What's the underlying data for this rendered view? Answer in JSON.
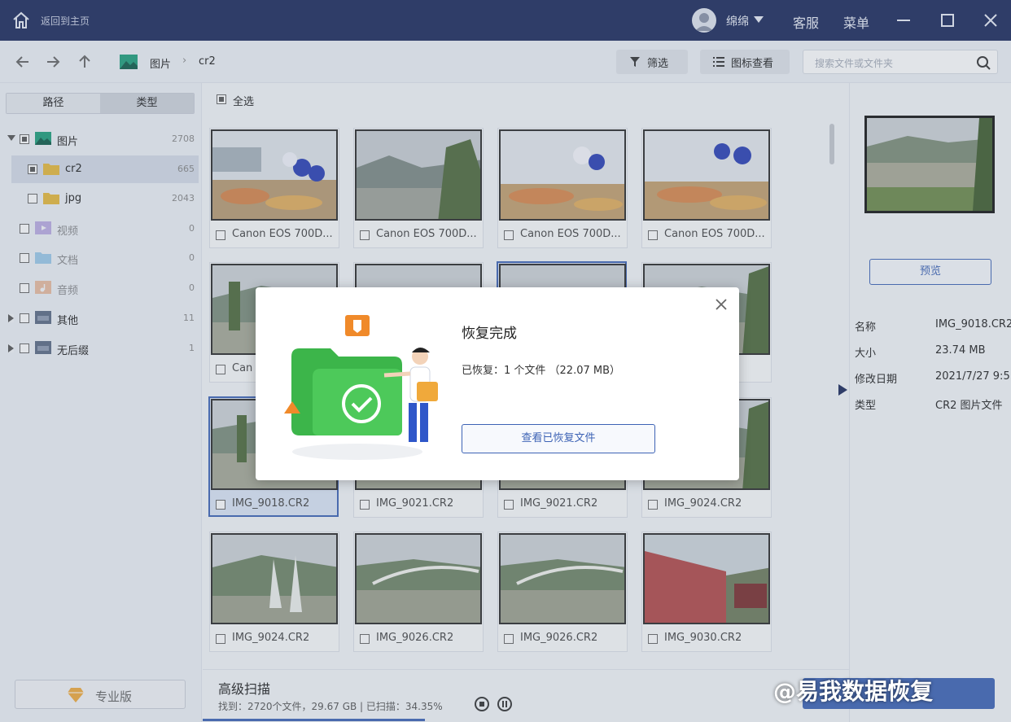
{
  "titlebar": {
    "back_label": "返回到主页",
    "user_name": "绵绵",
    "service_label": "客服",
    "menu_label": "菜单"
  },
  "toolbar": {
    "breadcrumb": [
      "图片",
      "cr2"
    ],
    "filter_label": "筛选",
    "view_label": "图标查看",
    "search_placeholder": "搜索文件或文件夹"
  },
  "sidebar": {
    "tabs": [
      "路径",
      "类型"
    ],
    "active_tab": "类型",
    "items": [
      {
        "label": "图片",
        "count": "2708"
      },
      {
        "label": "cr2",
        "count": "665"
      },
      {
        "label": "jpg",
        "count": "2043"
      },
      {
        "label": "视频",
        "count": "0"
      },
      {
        "label": "文档",
        "count": "0"
      },
      {
        "label": "音频",
        "count": "0"
      },
      {
        "label": "其他",
        "count": "11"
      },
      {
        "label": "无后缀",
        "count": "1"
      }
    ],
    "pro_label": "专业版"
  },
  "grid": {
    "select_all_label": "全选",
    "files": [
      {
        "name": "Canon EOS 700D..."
      },
      {
        "name": "Canon EOS 700D..."
      },
      {
        "name": "Canon EOS 700D..."
      },
      {
        "name": "Canon EOS 700D..."
      },
      {
        "name": "Can"
      },
      {
        "name": ""
      },
      {
        "name": ""
      },
      {
        "name": ""
      },
      {
        "name": "IMG_9018.CR2"
      },
      {
        "name": "IMG_9021.CR2"
      },
      {
        "name": "IMG_9021.CR2"
      },
      {
        "name": "IMG_9024.CR2"
      },
      {
        "name": "IMG_9024.CR2"
      },
      {
        "name": "IMG_9026.CR2"
      },
      {
        "name": "IMG_9026.CR2"
      },
      {
        "name": "IMG_9030.CR2"
      }
    ]
  },
  "details": {
    "preview_label": "预览",
    "props": [
      {
        "key": "名称",
        "value": "IMG_9018.CR2"
      },
      {
        "key": "大小",
        "value": "23.74 MB"
      },
      {
        "key": "修改日期",
        "value": "2021/7/27 9:5"
      },
      {
        "key": "类型",
        "value": "CR2 图片文件"
      }
    ]
  },
  "status": {
    "title": "高级扫描",
    "detail": "找到：2720个文件，29.67 GB | 已扫描：34.35%",
    "progress_percent": 34.35
  },
  "dialog": {
    "title": "恢复完成",
    "info": "已恢复：1 个文件 （22.07 MB）",
    "button_label": "查看已恢复文件"
  },
  "watermark": "@易我数据恢复",
  "colors": {
    "titlebar": "#1b2a5c",
    "accent": "#3d63b5",
    "success_green": "#3cb54a",
    "folder_yellow": "#e7b93a"
  }
}
